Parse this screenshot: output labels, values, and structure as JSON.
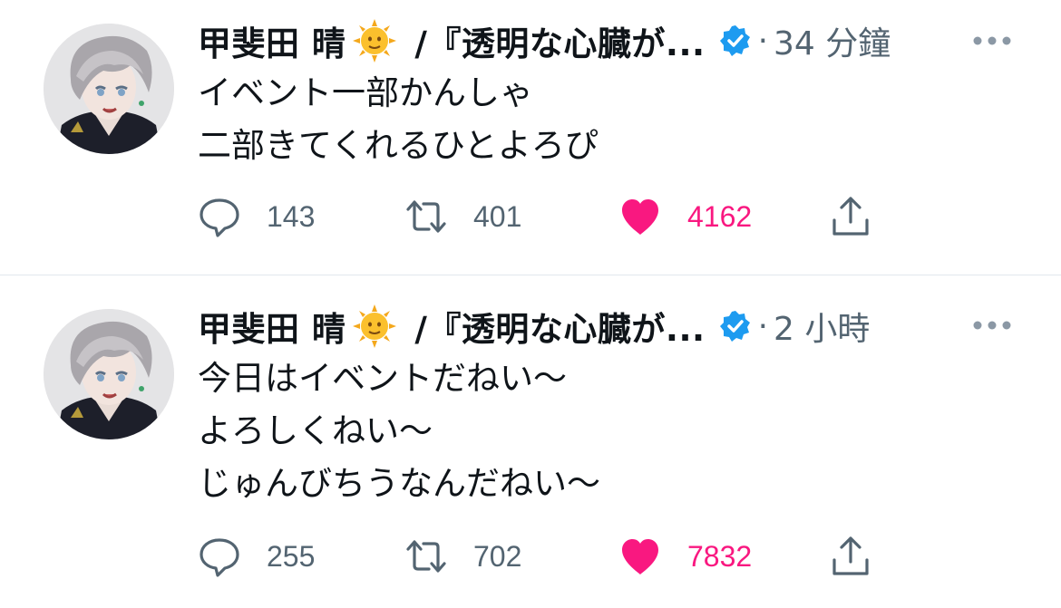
{
  "tweets": [
    {
      "author_name": "甲斐田 晴",
      "name_emoji": "sun-with-face",
      "handle": "/『透明な心臓が...",
      "verified": true,
      "separator": "·",
      "time": "34 分鐘",
      "lines": [
        "イベント一部かんしゃ",
        "二部きてくれるひとよろぴ"
      ],
      "replies": "143",
      "retweets": "401",
      "likes": "4162",
      "liked": true
    },
    {
      "author_name": "甲斐田 晴",
      "name_emoji": "sun-with-face",
      "handle": "/『透明な心臓が...",
      "verified": true,
      "separator": "·",
      "time": "2 小時",
      "lines": [
        "今日はイベントだねい〜",
        "よろしくねい〜",
        "じゅんびちうなんだねい〜"
      ],
      "replies": "255",
      "retweets": "702",
      "likes": "7832",
      "liked": true
    }
  ],
  "icons": {
    "reply": "speech-bubble-icon",
    "retweet": "retweet-icon",
    "like": "heart-icon",
    "share": "share-upload-icon",
    "more": "more-dots-icon",
    "verified": "verified-badge-icon"
  },
  "colors": {
    "text": "#0f1419",
    "secondary": "#536471",
    "like": "#f91880",
    "verified": "#1d9bf0",
    "divider": "#e1e8ed"
  }
}
